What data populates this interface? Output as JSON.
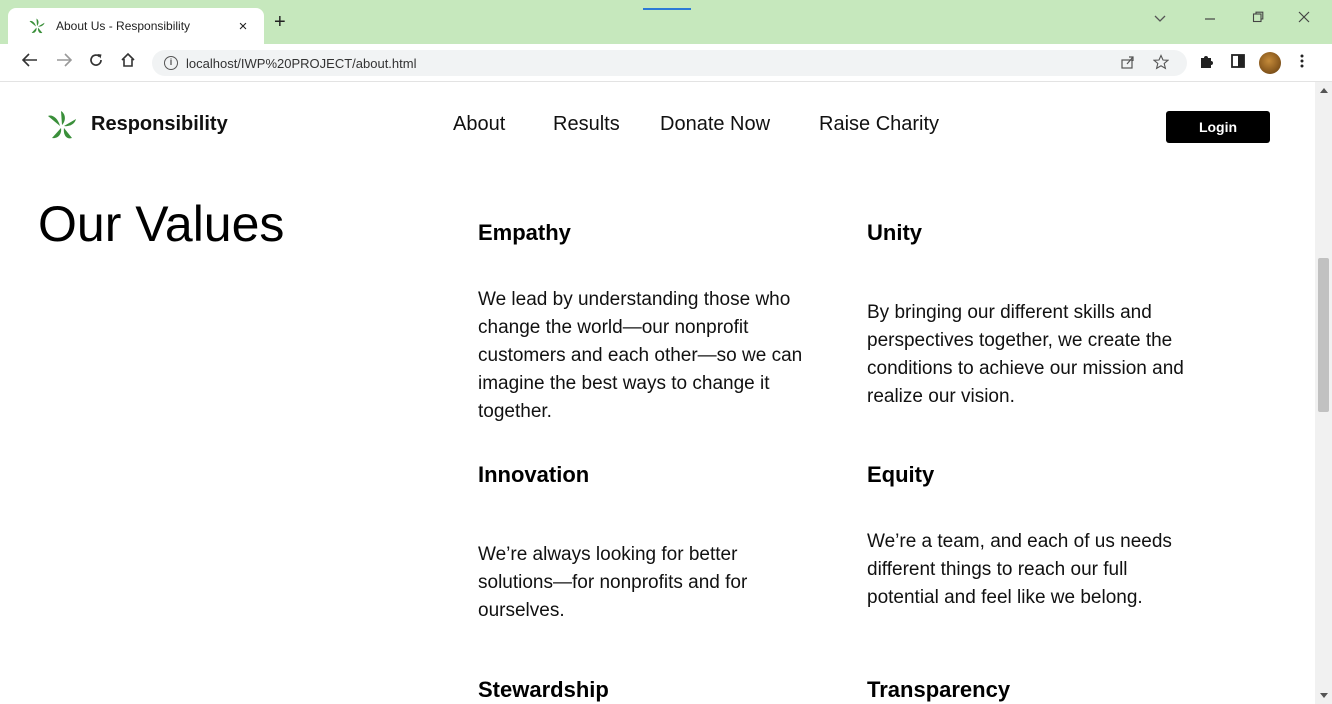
{
  "browser": {
    "tab_title": "About Us - Responsibility",
    "tab_close": "×",
    "new_tab": "+",
    "url": "localhost/IWP%20PROJECT/about.html",
    "info_glyph": "i"
  },
  "site": {
    "brand": "Responsibility",
    "nav": [
      "About",
      "Results",
      "Donate Now",
      "Raise Charity"
    ],
    "login_label": "Login",
    "logo_color": "#3a8f3a"
  },
  "values": {
    "title": "Our Values",
    "items": [
      {
        "heading": "Empathy",
        "body": "We lead by understanding those who change the world—our nonprofit customers and each other—so we can imagine the best ways to change it together."
      },
      {
        "heading": "Unity",
        "body": "By bringing our different skills and perspectives together, we create the conditions to achieve our mission and realize our vision."
      },
      {
        "heading": "Innovation",
        "body": "We’re always looking for better solutions—for nonprofits and for ourselves."
      },
      {
        "heading": "Equity",
        "body": "We’re a team, and each of us needs different things to reach our full potential and feel like we belong."
      },
      {
        "heading": "Stewardship",
        "body": ""
      },
      {
        "heading": "Transparency",
        "body": ""
      }
    ]
  }
}
